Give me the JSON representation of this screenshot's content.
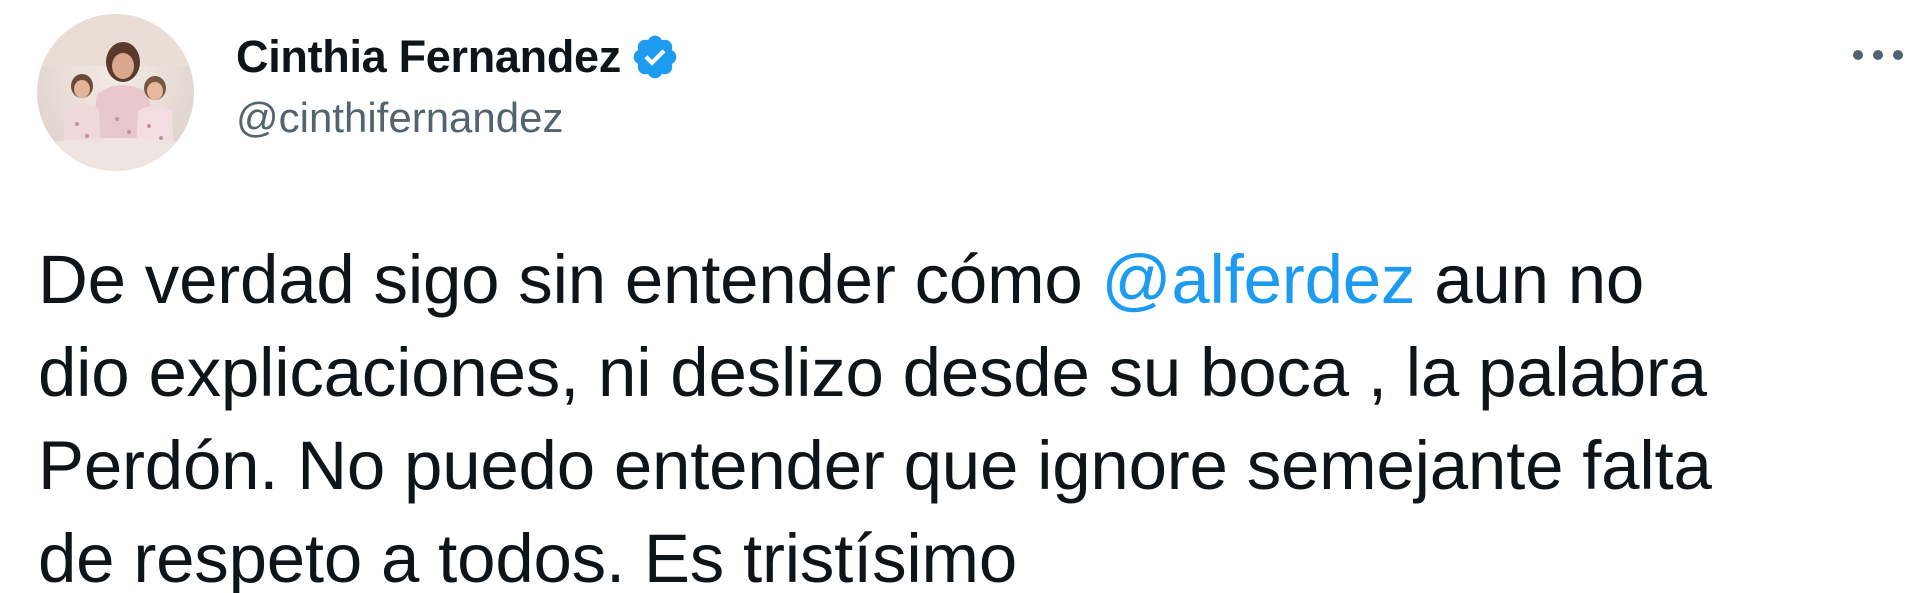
{
  "user": {
    "display_name": "Cinthia Fernandez",
    "handle": "@cinthifernandez",
    "verified_icon": "verified-badge-icon",
    "avatar_icon": "profile-photo"
  },
  "menu": {
    "more_icon": "more-options-icon"
  },
  "tweet": {
    "line1_a": "De verdad sigo sin entender cómo ",
    "mention": "@alferdez",
    "line1_b": " aun no",
    "line2": "dio explicaciones, ni deslizo desde su boca , la palabra",
    "line3": "Perdón. No puedo entender que ignore semejante falta",
    "line4": "de respeto a todos. Es tristísimo"
  },
  "colors": {
    "text": "#0f1419",
    "secondary": "#536471",
    "link": "#1d9bf0",
    "verified": "#1d9bf0"
  }
}
